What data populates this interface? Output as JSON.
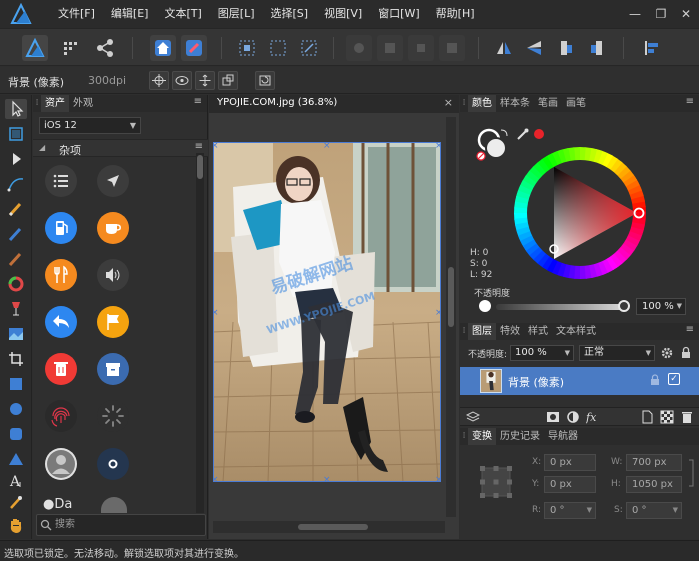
{
  "menu": {
    "items": [
      "文件[F]",
      "编辑[E]",
      "文本[T]",
      "图层[L]",
      "选择[S]",
      "视图[V]",
      "窗口[W]",
      "帮助[H]"
    ]
  },
  "window_controls": {
    "minimize": "—",
    "restore": "❐",
    "close": "✕"
  },
  "context_bar": {
    "layer": "背景 (像素)",
    "dpi": "300dpi"
  },
  "assets_panel": {
    "tabs": [
      "资产",
      "外观"
    ],
    "menu": "≡",
    "preset": "iOS 12",
    "category": "杂项",
    "search_placeholder": "搜索",
    "partial_item_text": "Da"
  },
  "document": {
    "title": "YPOJIE.COM.jpg (36.8%)",
    "close": "×",
    "watermark_line1": "易破解网站",
    "watermark_line2": "WWW.YPOJIE.COM"
  },
  "color_panel": {
    "tabs": [
      "颜色",
      "样本条",
      "笔画",
      "画笔"
    ],
    "h": "H: 0",
    "s": "S: 0",
    "l": "L: 92",
    "opacity_label": "不透明度",
    "opacity_value": "100 %",
    "opacity_fraction": 1.0,
    "hue_color": "#e8232a"
  },
  "layers_panel": {
    "tabs": [
      "图层",
      "特效",
      "样式",
      "文本样式"
    ],
    "opacity_label": "不透明度:",
    "opacity_value": "100 %",
    "blend_mode": "正常",
    "layer_name": "背景 (像素)"
  },
  "transform_panel": {
    "tabs": [
      "变换",
      "历史记录",
      "导航器"
    ],
    "x_label": "X:",
    "x_value": "0 px",
    "y_label": "Y:",
    "y_value": "0 px",
    "w_label": "W:",
    "w_value": "700 px",
    "h_label": "H:",
    "h_value": "1050 px",
    "r_label": "R:",
    "r_value": "0 °",
    "s_label": "S:",
    "s_value": "0 °"
  },
  "status": "选取项已锁定。无法移动。解锁选取项对其进行变换。"
}
